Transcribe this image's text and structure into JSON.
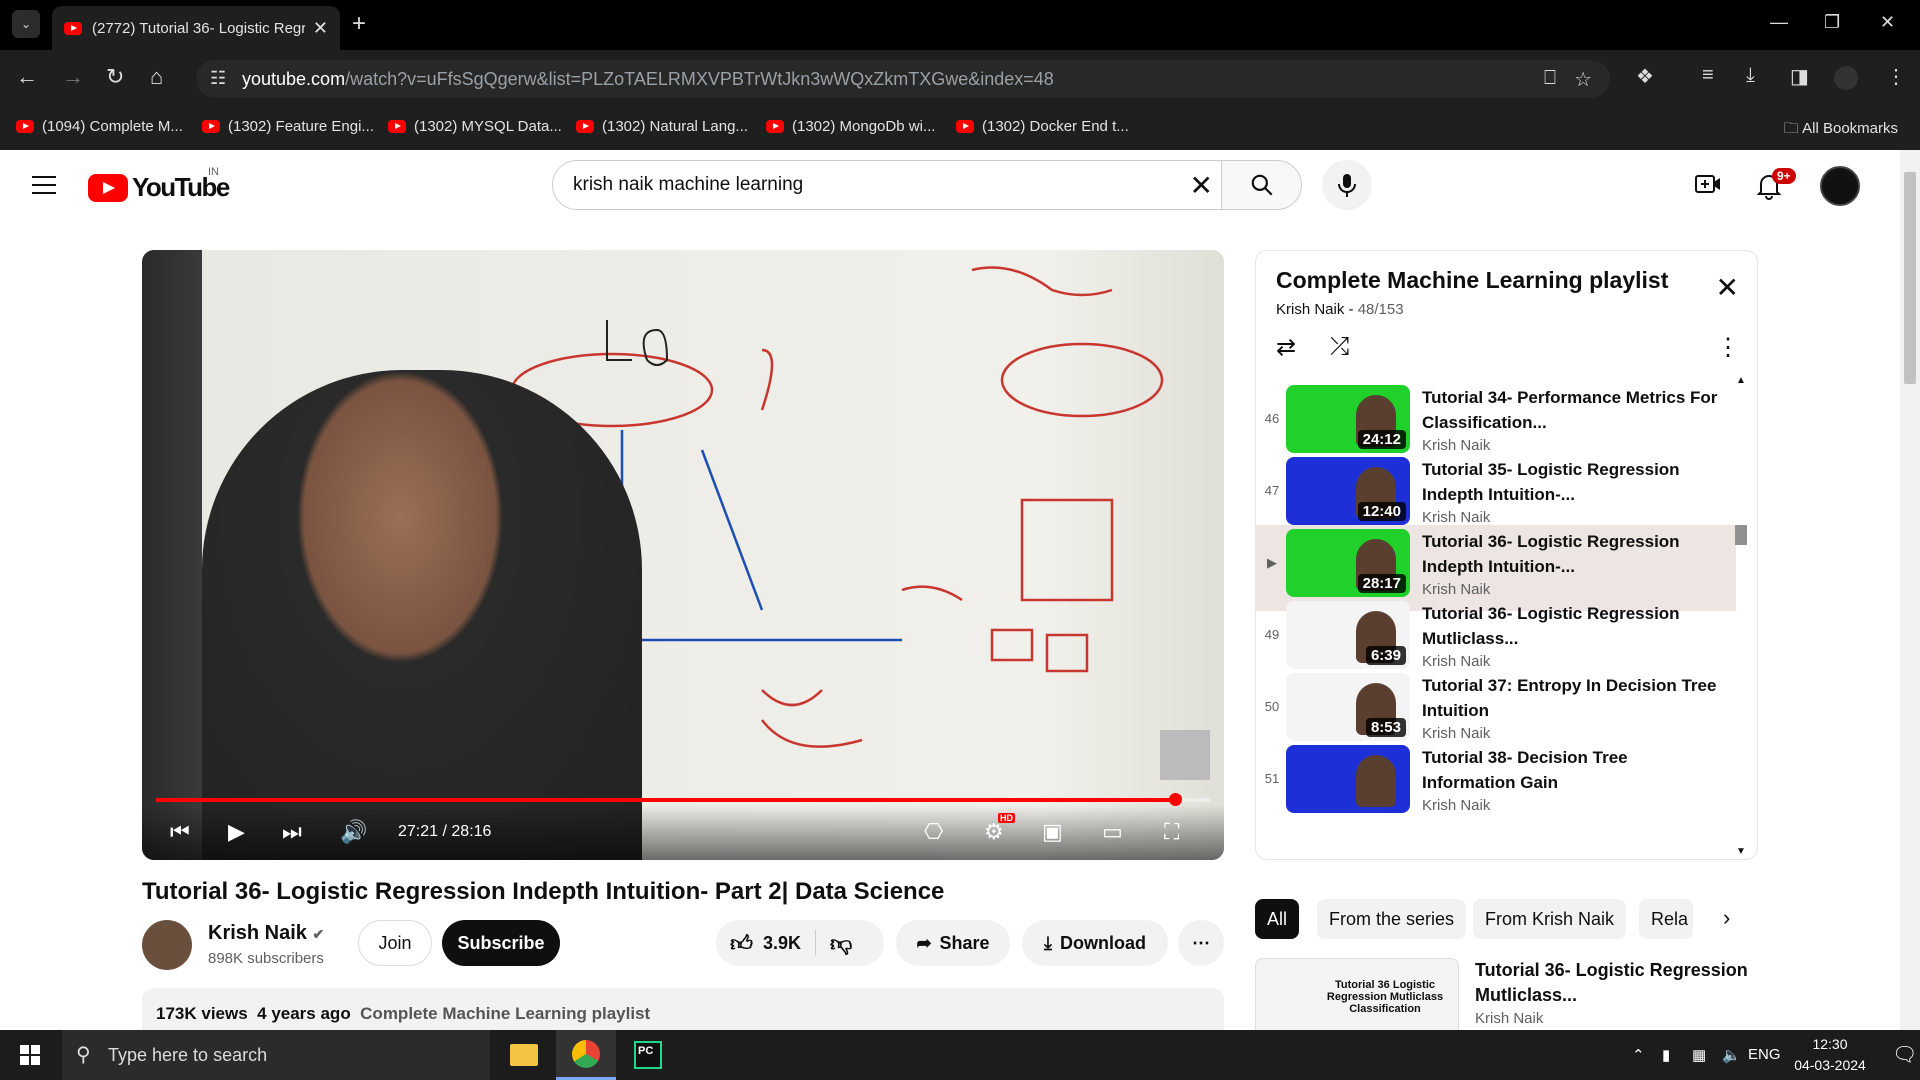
{
  "browser": {
    "tab_title": "(2772) Tutorial 36- Logistic Regr",
    "url_host": "youtube.com",
    "url_path": "/watch?v=uFfsSgQgerw&list=PLZoTAELRMXVPBTrWtJkn3wWQxZkmTXGwe&index=48",
    "bookmarks": [
      "(1094) Complete M...",
      "(1302) Feature Engi...",
      "(1302) MYSQL Data...",
      "(1302) Natural Lang...",
      "(1302) MongoDb wi...",
      "(1302) Docker End t..."
    ],
    "all_bookmarks": "All Bookmarks"
  },
  "masthead": {
    "logo_text": "YouTube",
    "country": "IN",
    "search_value": "krish naik machine learning",
    "notif_count": "9+"
  },
  "player": {
    "current_time": "27:21",
    "duration": "28:16",
    "progress": 0.967,
    "settings_badge": "HD"
  },
  "video": {
    "title": "Tutorial 36- Logistic Regression Indepth Intuition- Part 2| Data Science",
    "channel": "Krish Naik",
    "subscribers": "898K subscribers",
    "join": "Join",
    "subscribe": "Subscribe",
    "likes": "3.9K",
    "share": "Share",
    "download": "Download",
    "views": "173K views",
    "age": "4 years ago",
    "playlist_link": "Complete Machine Learning playlist"
  },
  "playlist": {
    "title": "Complete Machine Learning playlist",
    "author": "Krish Naik",
    "position": "48/153",
    "items": [
      {
        "idx": "46",
        "title": "Tutorial 34- Performance Metrics For Classification...",
        "author": "Krish Naik",
        "dur": "24:12",
        "color": "#1fd12a"
      },
      {
        "idx": "47",
        "title": "Tutorial 35- Logistic Regression Indepth Intuition-...",
        "author": "Krish Naik",
        "dur": "12:40",
        "color": "#1d2fd6"
      },
      {
        "idx": "▶",
        "title": "Tutorial 36- Logistic Regression Indepth Intuition-...",
        "author": "Krish Naik",
        "dur": "28:17",
        "color": "#1fd12a"
      },
      {
        "idx": "49",
        "title": "Tutorial 36- Logistic Regression Mutliclass...",
        "author": "Krish Naik",
        "dur": "6:39",
        "color": "#f4f4f4"
      },
      {
        "idx": "50",
        "title": "Tutorial 37: Entropy In Decision Tree Intuition",
        "author": "Krish Naik",
        "dur": "8:53",
        "color": "#f4f4f4"
      },
      {
        "idx": "51",
        "title": "Tutorial 38- Decision Tree Information Gain",
        "author": "Krish Naik",
        "dur": "",
        "color": "#1d2fd6"
      }
    ]
  },
  "chips": [
    "All",
    "From the series",
    "From Krish Naik",
    "Rela"
  ],
  "recommendation": {
    "thumb_text": "Tutorial 36 Logistic Regression Mutliclass Classification",
    "title": "Tutorial 36- Logistic Regression Mutliclass...",
    "author": "Krish Naik"
  },
  "taskbar": {
    "search_placeholder": "Type here to search",
    "lang": "ENG",
    "time": "12:30",
    "date": "04-03-2024"
  }
}
